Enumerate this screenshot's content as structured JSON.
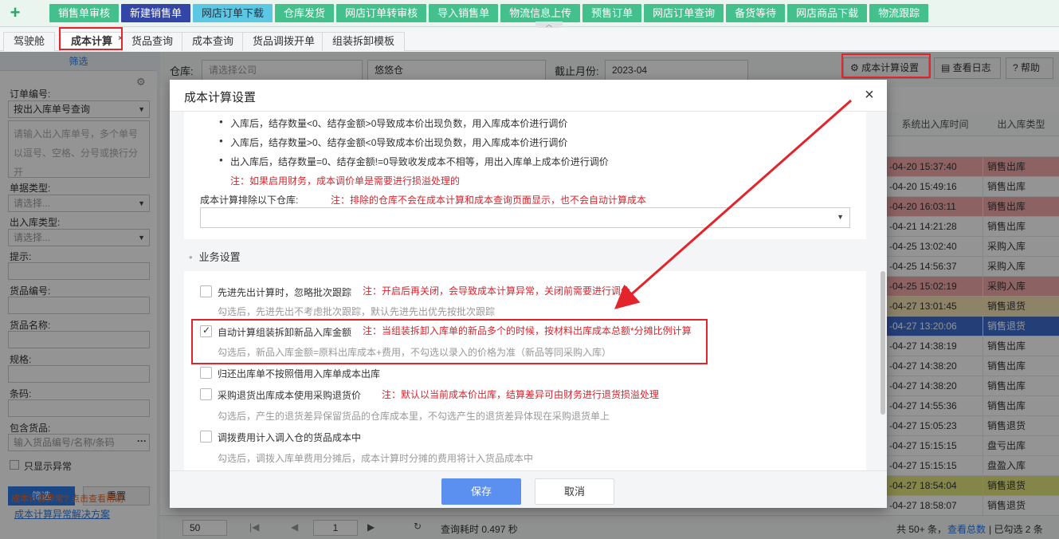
{
  "topbar": {
    "plus_label": "+",
    "buttons": [
      "销售单审核",
      "新建销售单",
      "网店订单下载",
      "仓库发货",
      "网店订单转审核",
      "导入销售单",
      "物流信息上传",
      "预售订单",
      "网店订单查询",
      "备货等待",
      "网店商品下载",
      "物流跟踪"
    ]
  },
  "tabs": [
    "驾驶舱",
    "成本计算",
    "货品查询",
    "成本查询",
    "货品调拨开单",
    "组装拆卸模板"
  ],
  "tab_close": "×",
  "sidebar": {
    "header": "筛选",
    "order_no_label": "订单编号:",
    "order_no_mode": "按出入库单号查询",
    "order_no_placeholder": "请输入出入库单号，多个单号以逗号、空格、分号或换行分开",
    "doc_type_label": "单据类型:",
    "doc_type_placeholder": "请选择...",
    "io_type_label": "出入库类型:",
    "io_type_placeholder": "请选择...",
    "tips_label": "提示:",
    "sku_label": "货品编号:",
    "name_label": "货品名称:",
    "spec_label": "规格:",
    "barcode_label": "条码:",
    "contains_label": "包含货品:",
    "contains_placeholder": "输入货品编号/名称/条码",
    "contains_more": "···",
    "only_abnormal": "只显示异常",
    "filter_btn": "筛选",
    "reset_btn": "重置",
    "help_text": "成本计算异常解决方案",
    "help_overlay": "成本计算异常? 点击查看帮助:"
  },
  "filterbar": {
    "warehouse_label": "仓库:",
    "company_placeholder": "请选择公司",
    "warehouse_value": "悠悠仓",
    "month_label": "截止月份:",
    "month_value": "2023-04",
    "settings_btn": "成本计算设置",
    "log_btn": "查看日志",
    "help_btn": "帮助"
  },
  "grid": {
    "col1": "系统出入库时间",
    "col2": "出入库类型",
    "rows": [
      [
        "-04-20 15:37:40",
        "销售出库",
        "red"
      ],
      [
        "-04-20 15:49:16",
        "销售出库",
        ""
      ],
      [
        "-04-20 16:03:11",
        "销售出库",
        "red"
      ],
      [
        "-04-21 14:21:28",
        "销售出库",
        ""
      ],
      [
        "-04-25 13:02:40",
        "采购入库",
        ""
      ],
      [
        "-04-25 14:56:37",
        "采购入库",
        ""
      ],
      [
        "-04-25 15:02:19",
        "采购入库",
        "red"
      ],
      [
        "-04-27 13:01:45",
        "销售退货",
        "yel"
      ],
      [
        "-04-27 13:20:06",
        "销售退货",
        "blue"
      ],
      [
        "-04-27 14:38:19",
        "销售出库",
        ""
      ],
      [
        "-04-27 14:38:20",
        "销售出库",
        ""
      ],
      [
        "-04-27 14:38:20",
        "销售出库",
        ""
      ],
      [
        "-04-27 14:55:36",
        "销售出库",
        ""
      ],
      [
        "-04-27 15:05:23",
        "销售退货",
        ""
      ],
      [
        "-04-27 15:15:15",
        "盘亏出库",
        ""
      ],
      [
        "-04-27 15:15:15",
        "盘盈入库",
        ""
      ],
      [
        "-04-27 18:54:04",
        "销售退货",
        "ylw2"
      ],
      [
        "-04-27 18:58:07",
        "销售退货",
        ""
      ]
    ]
  },
  "pager": {
    "page_size": "50",
    "page": "1",
    "query_time": "查询耗时 0.497 秒",
    "total": "共 50+ 条，",
    "view_total": "查看总数",
    "selected": "| 已勾选 2 条"
  },
  "modal": {
    "title": "成本计算设置",
    "close": "×",
    "bullets": [
      "入库后，结存数量<0、结存金额>0导致成本价出现负数，用入库成本价进行调价",
      "入库后，结存数量>0、结存金额<0导致成本价出现负数，用入库成本价进行调价",
      "出入库后，结存数量=0、结存金额!=0导致收发成本不相等，用出入库单上成本价进行调价"
    ],
    "finance_note": "注：如果启用财务，成本调价单是需要进行损溢处理的",
    "exclude_label": "成本计算排除以下仓库:",
    "exclude_note": "注：排除的仓库不会在成本计算和成本查询页面显示，也不会自动计算成本",
    "biz_title": "业务设置",
    "options": [
      {
        "label": "先进先出计算时，忽略批次跟踪",
        "note": "注：开启后再关闭，会导致成本计算异常，关闭前需要进行调价",
        "desc": "勾选后，先进先出不考虑批次跟踪，默认先进先出优先按批次跟踪",
        "checked": false
      },
      {
        "label": "自动计算组装拆卸新品入库金额",
        "note": "注：当组装拆卸入库单的新品多个的时候，按材料出库成本总额*分摊比例计算",
        "desc": "勾选后，新品入库金额=原料出库成本+费用，不勾选以录入的价格为准（新品等同采购入库）",
        "checked": true
      },
      {
        "label": "归还出库单不按照借用入库单成本出库",
        "note": "",
        "desc": "",
        "checked": false
      },
      {
        "label": "采购退货出库成本使用采购退货价",
        "note": "注：默认以当前成本价出库，结算差异可由财务进行退货损溢处理",
        "desc": "勾选后，产生的退货差异保留货品的仓库成本里，不勾选产生的退货差异体现在采购退货单上",
        "checked": false
      },
      {
        "label": "调拨费用计入调入仓的货品成本中",
        "note": "",
        "desc": "勾选后，调拨入库单费用分摊后，成本计算时分摊的费用将计入货品成本中",
        "checked": false
      }
    ],
    "save_btn": "保存",
    "cancel_btn": "取消"
  },
  "colors": {
    "accent": "#43c08b",
    "active_nav": "#3346a8",
    "primary_btn": "#5b8ff0",
    "annotation": "#e3242b",
    "note_red": "#d9232d"
  }
}
